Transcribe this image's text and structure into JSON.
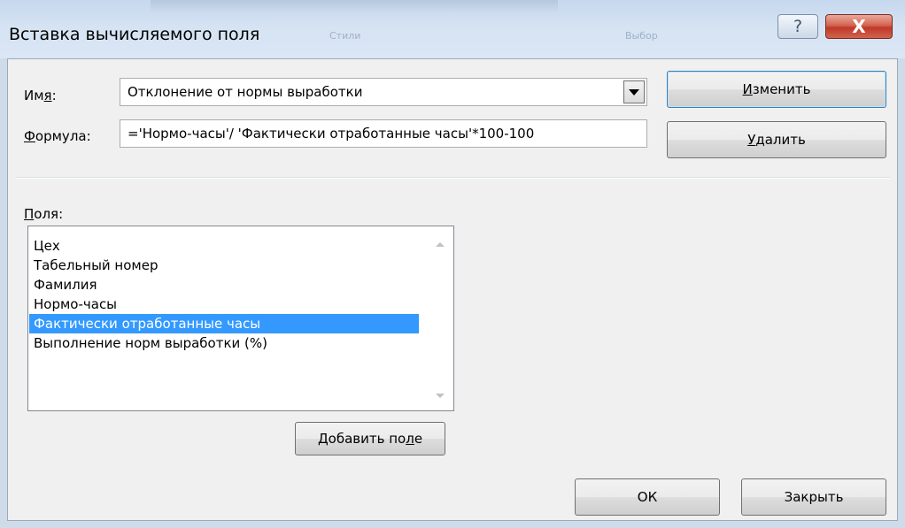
{
  "window": {
    "title": "Вставка вычисляемого поля",
    "help_glyph": "?",
    "close_glyph": "X",
    "background_labels": [
      "Стили",
      "Выбор"
    ],
    "colors": {
      "close_red": "#c0392a",
      "selection_blue": "#3399ff"
    }
  },
  "form": {
    "name_label_pre": "Им",
    "name_label_accel": "я",
    "name_label_post": ":",
    "name_value": "Отклонение от нормы выработки",
    "formula_label_accel": "Ф",
    "formula_label_post": "ормула:",
    "formula_value": "='Нормо-часы'/ 'Фактически отработанные часы'*100-100"
  },
  "buttons": {
    "modify_accel": "И",
    "modify_rest": "зменить",
    "delete_accel": "У",
    "delete_rest": "далить",
    "add_field_pre": "Добавить по",
    "add_field_accel": "л",
    "add_field_post": "е",
    "ok": "ОК",
    "close": "Закрыть"
  },
  "fields_section": {
    "label_accel": "П",
    "label_rest": "оля:",
    "items": [
      "Цех",
      "Табельный номер",
      "Фамилия",
      "Нормо-часы",
      "Фактически отработанные часы",
      "Выполнение норм выработки (%)"
    ],
    "selected_index": 4
  },
  "icons": {
    "combo": "chevron-down-icon",
    "help": "help-icon",
    "close": "close-icon",
    "scroll_up": "scroll-up-arrow-icon",
    "scroll_down": "scroll-down-arrow-icon"
  }
}
